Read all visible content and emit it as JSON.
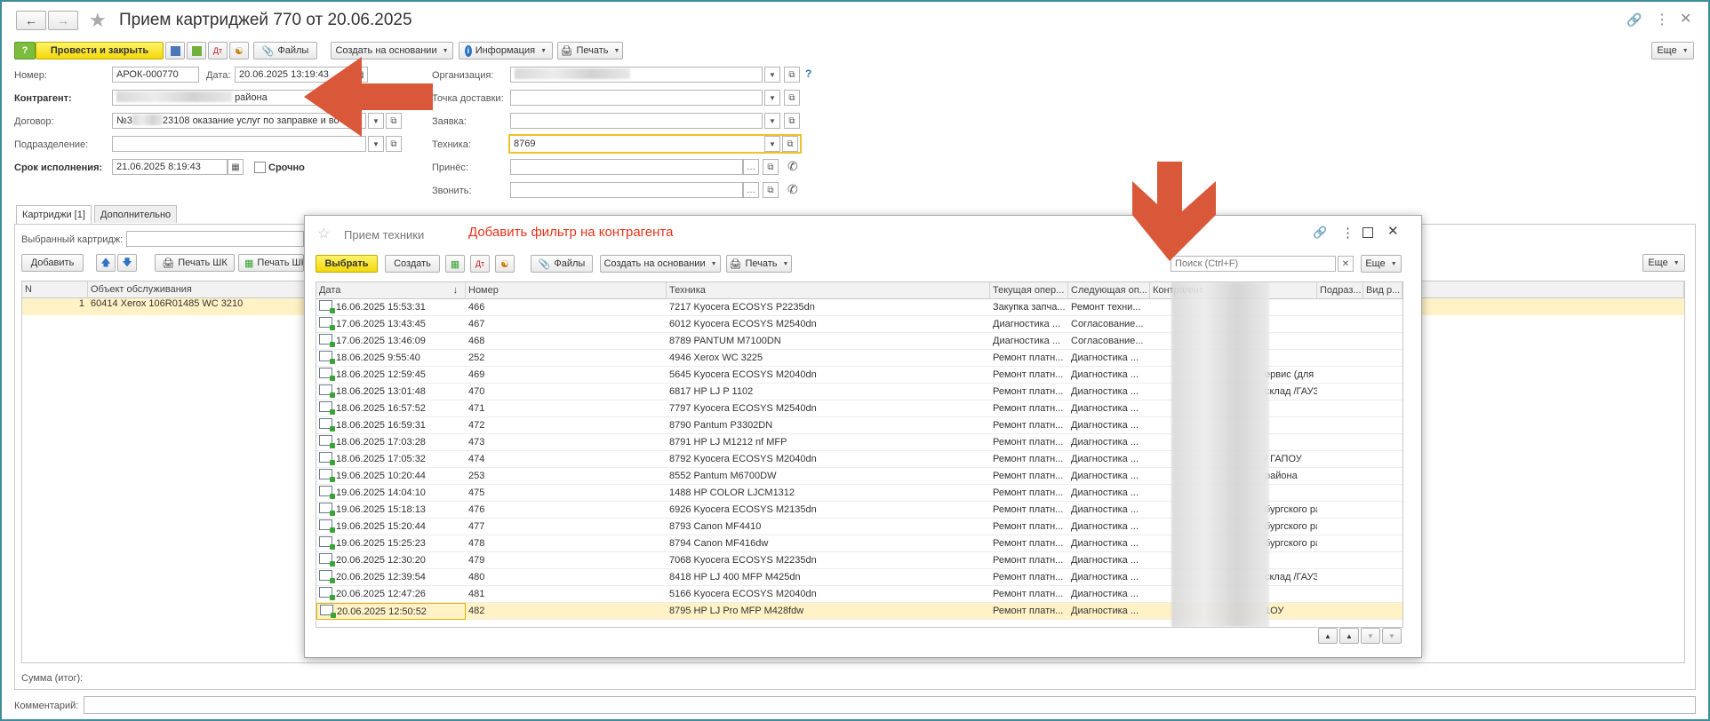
{
  "window": {
    "title": "Прием картриджей 770 от 20.06.2025"
  },
  "toolbar": {
    "post_close": "Провести и закрыть",
    "files": "Файлы",
    "create_based": "Создать на основании",
    "info": "Информация",
    "print": "Печать",
    "more": "Еще"
  },
  "form": {
    "number_label": "Номер:",
    "number_value": "АРОК-000770",
    "date_label": "Дата:",
    "date_value": "20.06.2025 13:19:43",
    "counterparty_label": "Контрагент:",
    "counterparty_value": "района",
    "contract_label": "Договор:",
    "contract_prefix": "№3",
    "contract_value": "23108 оказание услуг по заправке и во",
    "division_label": "Подразделение:",
    "deadline_label": "Срок исполнения:",
    "deadline_value": "21.06.2025  8:19:43",
    "urgent_label": "Срочно",
    "org_label": "Организация:",
    "delivery_label": "Точка доставки:",
    "request_label": "Заявка:",
    "equipment_label": "Техника:",
    "equipment_value": "8769",
    "brought_label": "Принёс:",
    "call_label": "Звонить:",
    "help": "?"
  },
  "tabs": [
    {
      "label": "Картриджи [1]"
    },
    {
      "label": "Дополнительно"
    }
  ],
  "cartridges": {
    "selected_label": "Выбранный картридж:",
    "add": "Добавить",
    "print_bc": "Печать ШК",
    "print_bc2": "Печать ШК",
    "more": "Еще",
    "col_n": "N",
    "col_object": "Объект обслуживания",
    "row_n": "1",
    "row_object": "60414 Xerox 106R01485 WC 3210"
  },
  "footer": {
    "sum_label": "Сумма (итог):",
    "comment_label": "Комментарий:"
  },
  "annotation": {
    "text": "Добавить фильтр на контрагента",
    "color": "#e8331c"
  },
  "arrow_color": "#d9583a",
  "dialog": {
    "title": "Прием техники",
    "select": "Выбрать",
    "create": "Создать",
    "files": "Файлы",
    "create_based": "Создать на основании",
    "print": "Печать",
    "search_placeholder": "Поиск (Ctrl+F)",
    "more": "Еще",
    "columns": [
      "Дата",
      "Номер",
      "Техника",
      "Текущая опер...",
      "Следующая оп...",
      "Контрагент",
      "Подраз...",
      "Вид р..."
    ],
    "rows": [
      {
        "date": "16.06.2025 15:53:31",
        "num": "466",
        "tech": "7217 Kyocera ECOSYS P2235dn",
        "cur": "Закупка запча...",
        "next": "Ремонт техни...",
        "contr": "",
        "dept": "",
        "kind": ""
      },
      {
        "date": "17.06.2025 13:43:45",
        "num": "467",
        "tech": "6012 Kyocera ECOSYS M2540dn",
        "cur": "Диагностика ...",
        "next": "Согласование...",
        "contr": "",
        "dept": "",
        "kind": ""
      },
      {
        "date": "17.06.2025 13:46:09",
        "num": "468",
        "tech": "8789 PANTUM M7100DN",
        "cur": "Диагностика ...",
        "next": "Согласование...",
        "contr": "",
        "dept": "",
        "kind": ""
      },
      {
        "date": "18.06.2025 9:55:40",
        "num": "252",
        "tech": "4946 Xerox WC 3225",
        "cur": "Ремонт платн...",
        "next": "Диагностика ...",
        "contr": "",
        "dept": "",
        "kind": ""
      },
      {
        "date": "18.06.2025 12:59:45",
        "num": "469",
        "tech": "5645 Kyocera ECOSYS M2040dn",
        "cur": "Ремонт платн...",
        "next": "Диагностика ...",
        "contr": "ервис (для в...",
        "dept": "",
        "kind": ""
      },
      {
        "date": "18.06.2025 13:01:48",
        "num": "470",
        "tech": "6817 HP LJ P 1102",
        "cur": "Ремонт платн...",
        "next": "Диагностика ...",
        "contr": "склад /ГАУЗ",
        "dept": "",
        "kind": ""
      },
      {
        "date": "18.06.2025 16:57:52",
        "num": "471",
        "tech": "7797 Kyocera ECOSYS M2540dn",
        "cur": "Ремонт платн...",
        "next": "Диагностика ...",
        "contr": "",
        "dept": "",
        "kind": ""
      },
      {
        "date": "18.06.2025 16:59:31",
        "num": "472",
        "tech": "8790 Pantum P3302DN",
        "cur": "Ремонт платн...",
        "next": "Диагностика ...",
        "contr": "",
        "dept": "",
        "kind": ""
      },
      {
        "date": "18.06.2025 17:03:28",
        "num": "473",
        "tech": "8791 HP LJ M1212 nf MFP",
        "cur": "Ремонт платн...",
        "next": "Диагностика ...",
        "contr": "",
        "dept": "",
        "kind": ""
      },
      {
        "date": "18.06.2025 17:05:32",
        "num": "474",
        "tech": "8792 Kyocera ECOSYS M2040dn",
        "cur": "Ремонт платн...",
        "next": "Диагностика ...",
        "contr": "/ ГАПОУ",
        "dept": "",
        "kind": ""
      },
      {
        "date": "19.06.2025 10:20:44",
        "num": "253",
        "tech": "8552 Pantum M6700DW",
        "cur": "Ремонт платн...",
        "next": "Диагностика ...",
        "contr": "района",
        "dept": "",
        "kind": ""
      },
      {
        "date": "19.06.2025 14:04:10",
        "num": "475",
        "tech": "1488 HP COLOR LJCM1312",
        "cur": "Ремонт платн...",
        "next": "Диагностика ...",
        "contr": "",
        "dept": "",
        "kind": ""
      },
      {
        "date": "19.06.2025 15:18:13",
        "num": "476",
        "tech": "6926 Kyocera ECOSYS M2135dn",
        "cur": "Ремонт платн...",
        "next": "Диагностика ...",
        "contr": "бургского ра...",
        "dept": "",
        "kind": ""
      },
      {
        "date": "19.06.2025 15:20:44",
        "num": "477",
        "tech": "8793 Canon MF4410",
        "cur": "Ремонт платн...",
        "next": "Диагностика ...",
        "contr": "бургского ра...",
        "dept": "",
        "kind": ""
      },
      {
        "date": "19.06.2025 15:25:23",
        "num": "478",
        "tech": "8794 Canon MF416dw",
        "cur": "Ремонт платн...",
        "next": "Диагностика ...",
        "contr": "бургского ра...",
        "dept": "",
        "kind": ""
      },
      {
        "date": "20.06.2025 12:30:20",
        "num": "479",
        "tech": "7068 Kyocera ECOSYS M2235dn",
        "cur": "Ремонт платн...",
        "next": "Диагностика ...",
        "contr": "",
        "dept": "",
        "kind": ""
      },
      {
        "date": "20.06.2025 12:39:54",
        "num": "480",
        "tech": "8418 HP LJ  400 MFP M425dn",
        "cur": "Ремонт платн...",
        "next": "Диагностика ...",
        "contr": "склад /ГАУЗ",
        "dept": "",
        "kind": ""
      },
      {
        "date": "20.06.2025 12:47:26",
        "num": "481",
        "tech": "5166 Kyocera ECOSYS M2040dn",
        "cur": "Ремонт платн...",
        "next": "Диагностика ...",
        "contr": "",
        "dept": "",
        "kind": ""
      },
      {
        "date": "20.06.2025 12:50:52",
        "num": "482",
        "tech": "8795 HP  LJ Pro MFP M428fdw",
        "cur": "Ремонт платн...",
        "next": "Диагностика ...",
        "contr": "1ОУ",
        "dept": "",
        "kind": ""
      }
    ]
  }
}
